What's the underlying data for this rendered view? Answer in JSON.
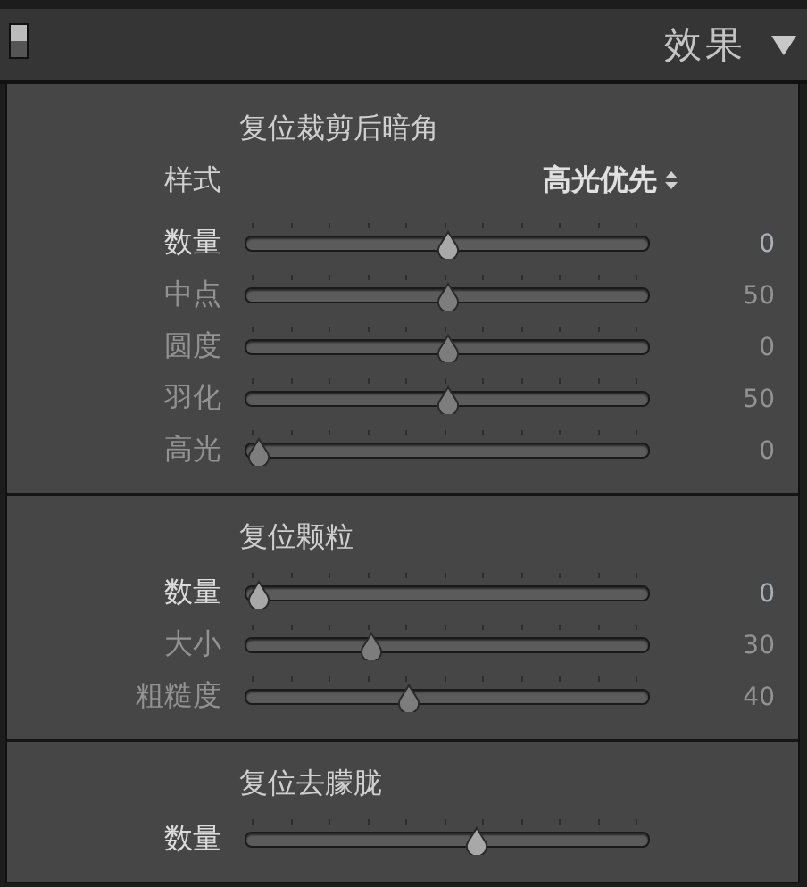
{
  "panel": {
    "title": "效果",
    "expanded": true
  },
  "sections": [
    {
      "title": "复位裁剪后暗角",
      "style": {
        "label": "样式",
        "value": "高光优先"
      },
      "sliders": [
        {
          "label": "数量",
          "level": 0.5,
          "reading": "0",
          "disabled": false
        },
        {
          "label": "中点",
          "level": 0.5,
          "reading": "50",
          "disabled": true
        },
        {
          "label": "圆度",
          "level": 0.5,
          "reading": "0",
          "disabled": true
        },
        {
          "label": "羽化",
          "level": 0.5,
          "reading": "50",
          "disabled": true
        },
        {
          "label": "高光",
          "level": 0,
          "reading": "0",
          "disabled": true
        }
      ]
    },
    {
      "title": "复位颗粒",
      "sliders": [
        {
          "label": "数量",
          "level": 0,
          "reading": "0",
          "disabled": false
        },
        {
          "label": "大小",
          "level": 0.3,
          "reading": "30",
          "disabled": true
        },
        {
          "label": "粗糙度",
          "level": 0.4,
          "reading": "40",
          "disabled": true
        }
      ]
    },
    {
      "title": "复位去朦胧",
      "sliders": [
        {
          "label": "数量",
          "level": 0.58,
          "disabled": false
        }
      ]
    }
  ]
}
